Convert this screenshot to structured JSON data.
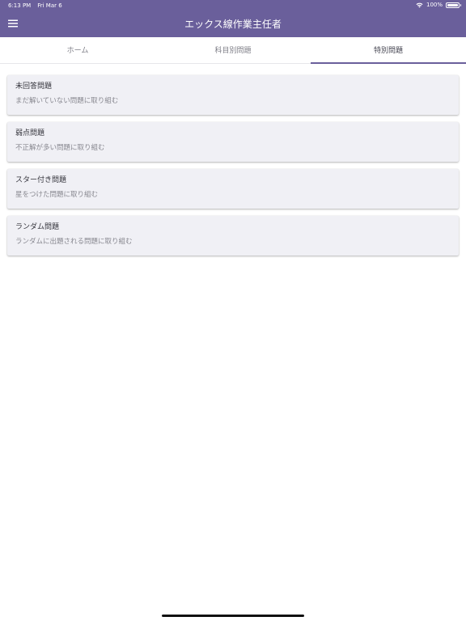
{
  "status_bar": {
    "time": "6:13 PM",
    "date": "Fri Mar 6",
    "battery_percent": "100%",
    "battery_level": 1.0,
    "wifi_icon": "wifi-icon",
    "battery_icon": "battery-icon"
  },
  "header": {
    "title": "エックス線作業主任者",
    "menu_icon": "hamburger-menu-icon",
    "background_color": "#6a5f9b"
  },
  "tabs": [
    {
      "label": "ホーム",
      "active": false
    },
    {
      "label": "科目別問題",
      "active": false
    },
    {
      "label": "特別問題",
      "active": true
    }
  ],
  "items": [
    {
      "title": "未回答問題",
      "subtitle": "まだ解いていない問題に取り組む"
    },
    {
      "title": "弱点問題",
      "subtitle": "不正解が多い問題に取り組む"
    },
    {
      "title": "スター付き問題",
      "subtitle": "星をつけた問題に取り組む"
    },
    {
      "title": "ランダム問題",
      "subtitle": "ランダムに出題される問題に取り組む"
    }
  ],
  "colors": {
    "accent": "#6a5f9b",
    "card_background": "#f0f0f5",
    "text_primary": "#33333b",
    "text_secondary": "#888890"
  }
}
